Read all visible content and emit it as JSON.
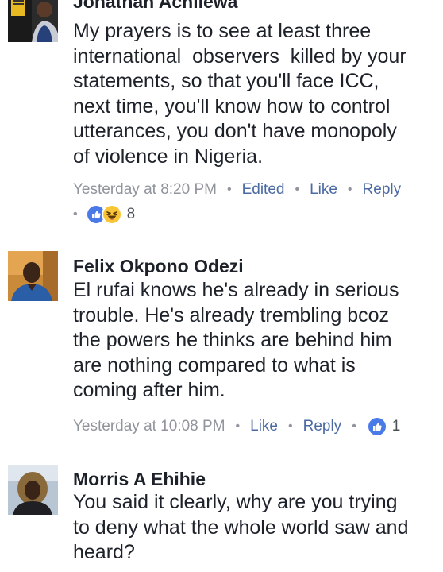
{
  "comments": [
    {
      "author": "Jonathan Achilewa",
      "lines": [
        "My prayers is to see at least three",
        "international  observers  killed by your",
        "statements, so that you'll face ICC,",
        "next time, you'll know how to control",
        "utterances, you don't have monopoly",
        "of violence in Nigeria."
      ],
      "time": "Yesterday at 8:20 PM",
      "edited": "Edited",
      "like": "Like",
      "reply": "Reply",
      "reaction_count": "8",
      "reactions": [
        "like-icon",
        "haha-icon"
      ]
    },
    {
      "author": "Felix Okpono Odezi",
      "lines": [
        "El rufai knows he's already in serious",
        "trouble. He's already trembling bcoz",
        "the powers he thinks are behind him",
        "are nothing compared to what is",
        "coming after him."
      ],
      "time": "Yesterday at 10:08 PM",
      "like": "Like",
      "reply": "Reply",
      "reaction_count": "1",
      "reactions": [
        "like-icon"
      ]
    },
    {
      "author": "Morris A Ehihie",
      "lines": [
        "You said it clearly, why are you trying",
        "to deny what the whole world saw and",
        "heard?"
      ]
    }
  ],
  "colors": {
    "text": "#1d2129",
    "meta": "#90949c",
    "action": "#4b6aa4",
    "like_blue": "#4a79e8",
    "haha_yellow": "#f7c536"
  },
  "separator": "•"
}
